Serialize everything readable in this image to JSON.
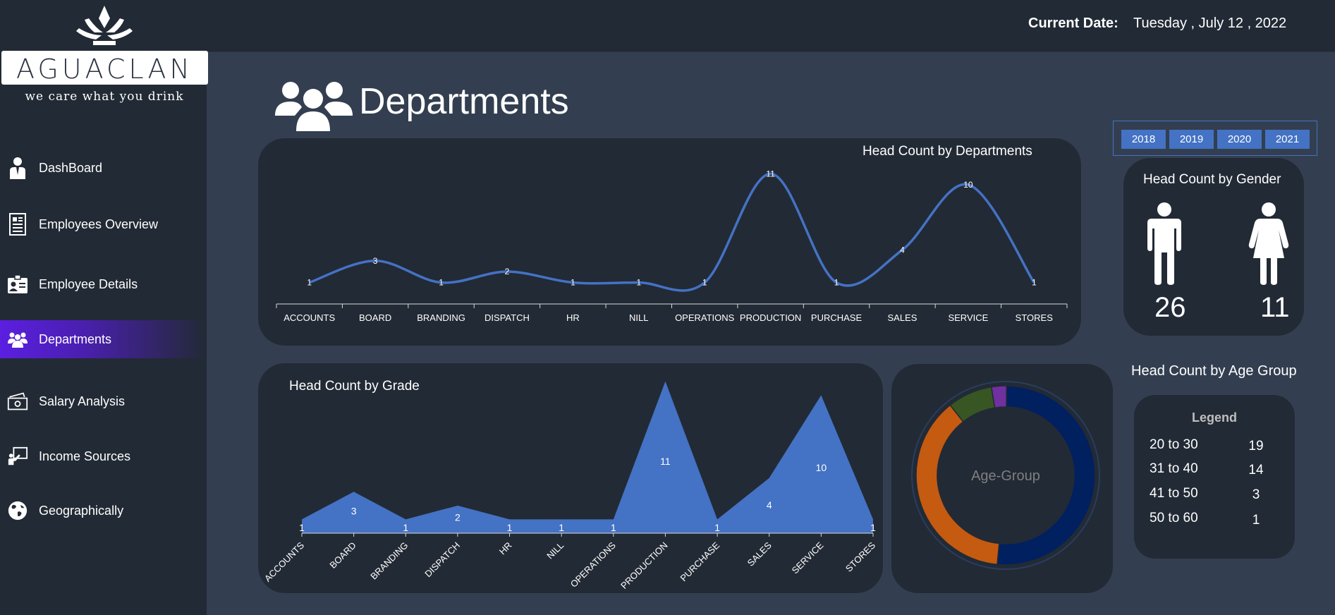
{
  "header": {
    "date_label": "Current Date:",
    "date_value": "Tuesday , July  12 ,  2022"
  },
  "brand": {
    "name": "AGUACLAN",
    "tagline": "we care what you drink"
  },
  "sidebar": {
    "items": [
      {
        "label": "DashBoard",
        "icon": "businessman-icon"
      },
      {
        "label": "Employees Overview",
        "icon": "newspaper-icon"
      },
      {
        "label": "Employee Details",
        "icon": "id-card-icon"
      },
      {
        "label": "Departments",
        "icon": "people-group-icon",
        "active": true
      },
      {
        "label": "Salary Analysis",
        "icon": "money-icon"
      },
      {
        "label": "Income Sources",
        "icon": "presentation-icon"
      },
      {
        "label": "Geographically",
        "icon": "globe-icon"
      }
    ]
  },
  "page": {
    "title": "Departments",
    "icon": "people-group-icon"
  },
  "years": [
    "2018",
    "2019",
    "2020",
    "2021"
  ],
  "colors": {
    "accent": "#4472c4",
    "panel": "#222a35",
    "background": "#333f50",
    "active_nav": "#5b1fe0",
    "age_20_30": "#002060",
    "age_31_40": "#c55a11",
    "age_41_50": "#375623",
    "age_50_60": "#7030a0"
  },
  "gender": {
    "title": "Head Count by Gender",
    "male_count": "26",
    "female_count": "11"
  },
  "age_group": {
    "title": "Head Count by Age Group",
    "donut_label": "Age-Group",
    "legend_title": "Legend",
    "rows": [
      {
        "range": "20 to 30",
        "count": "19"
      },
      {
        "range": "31 to 40",
        "count": "14"
      },
      {
        "range": "41 to 50",
        "count": "3"
      },
      {
        "range": "50 to 60",
        "count": "1"
      }
    ]
  },
  "chart_data": [
    {
      "type": "line",
      "title": "Head Count by Departments",
      "categories": [
        "ACCOUNTS",
        "BOARD",
        "BRANDING",
        "DISPATCH",
        "HR",
        "NILL",
        "OPERATIONS",
        "PRODUCTION",
        "PURCHASE",
        "SALES",
        "SERVICE",
        "STORES"
      ],
      "values": [
        1,
        3,
        1,
        2,
        1,
        1,
        1,
        11,
        1,
        4,
        10,
        1
      ],
      "ylim": [
        0,
        12
      ],
      "grid": false,
      "smooth": true
    },
    {
      "type": "area",
      "title": "Head Count by Grade",
      "categories": [
        "ACCOUNTS",
        "BOARD",
        "BRANDING",
        "DISPATCH",
        "HR",
        "NILL",
        "OPERATIONS",
        "PRODUCTION",
        "PURCHASE",
        "SALES",
        "SERVICE",
        "STORES"
      ],
      "values": [
        1,
        3,
        1,
        2,
        1,
        1,
        1,
        11,
        1,
        4,
        10,
        1
      ],
      "ylim": [
        0,
        11.5
      ],
      "grid": false
    },
    {
      "type": "pie",
      "title": "Age-Group",
      "categories": [
        "20 to 30",
        "31 to 40",
        "41 to 50",
        "50 to 60"
      ],
      "values": [
        19,
        14,
        3,
        1
      ],
      "donut": true
    }
  ]
}
